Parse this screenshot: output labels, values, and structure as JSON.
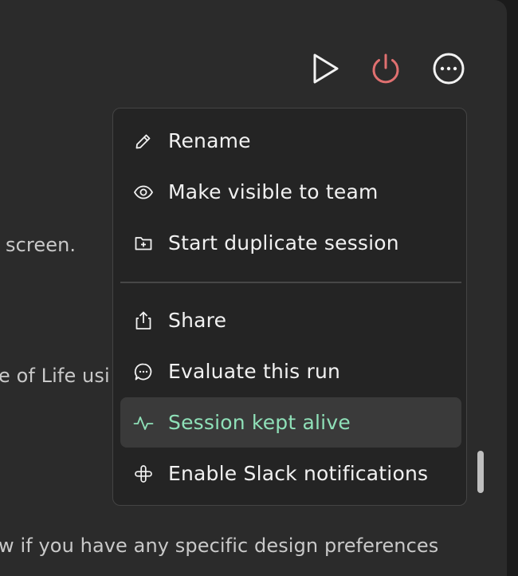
{
  "toolbar": {
    "play_icon": "play-icon",
    "power_icon": "power-icon",
    "more_icon": "more-horizontal-circle-icon",
    "power_color": "#e07070"
  },
  "background_text": {
    "line1": "screen.",
    "line2": "e of Life usi",
    "line3": "w if you have any specific design preferences"
  },
  "menu": {
    "items": [
      {
        "label": "Rename",
        "icon": "pencil-icon"
      },
      {
        "label": "Make visible to team",
        "icon": "eye-icon"
      },
      {
        "label": "Start duplicate session",
        "icon": "folder-plus-icon"
      },
      {
        "label": "Share",
        "icon": "share-icon"
      },
      {
        "label": "Evaluate this run",
        "icon": "chat-bubble-icon"
      },
      {
        "label": "Session kept alive",
        "icon": "activity-icon",
        "active": true
      },
      {
        "label": "Enable Slack notifications",
        "icon": "slack-icon"
      }
    ],
    "accent_color": "#8fe0b8"
  }
}
